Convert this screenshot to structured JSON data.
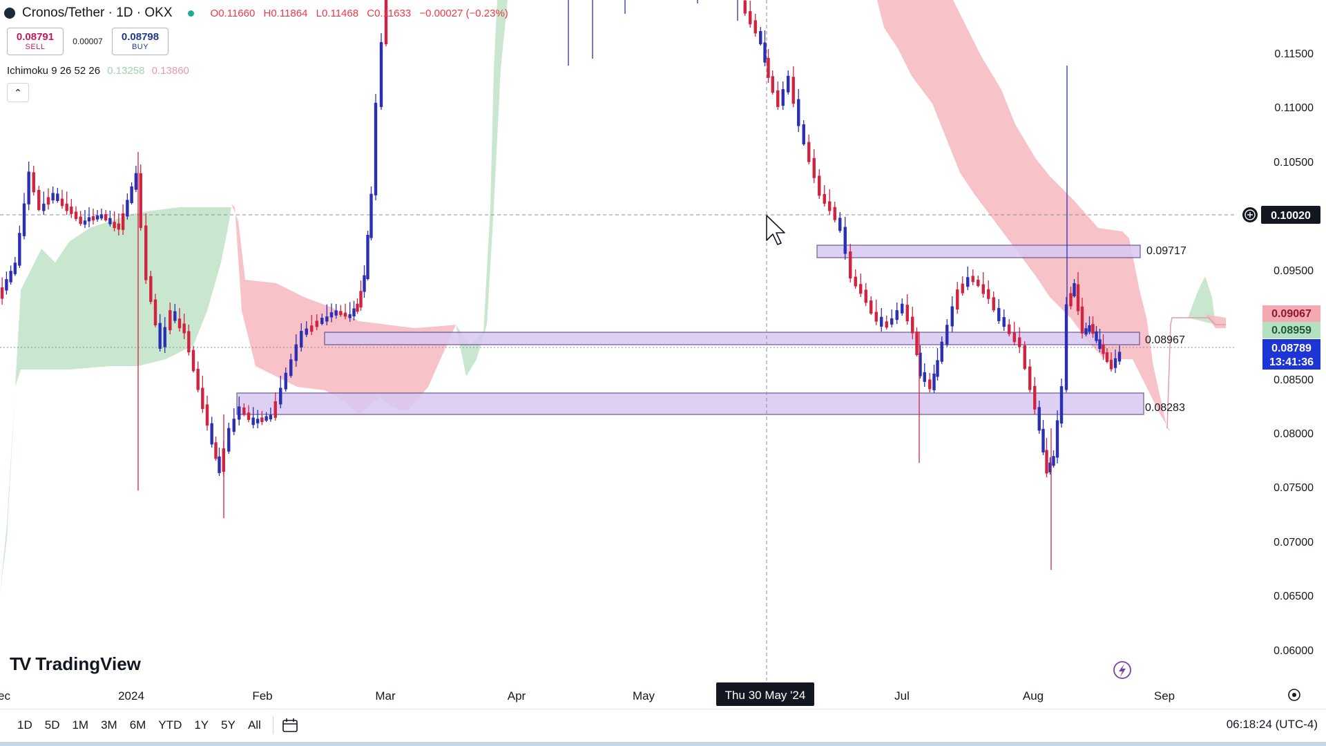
{
  "header": {
    "symbol": "Cronos/Tether · 1D · OKX",
    "open": "O0.11660",
    "high": "H0.11864",
    "low": "L0.11468",
    "close": "C0.11633",
    "change": "−0.00027 (−0.23%)"
  },
  "trade": {
    "sell_price": "0.08791",
    "sell_label": "SELL",
    "spread": "0.00007",
    "buy_price": "0.08798",
    "buy_label": "BUY"
  },
  "indicator": {
    "name": "Ichimoku 9 26 52 26",
    "value_a": "0.13258",
    "value_b": "0.13860"
  },
  "brand": "TradingView",
  "price_axis": {
    "ticks": [
      "0.11500",
      "0.11000",
      "0.10500",
      "0.09500",
      "0.08500",
      "0.08000",
      "0.07500",
      "0.07000",
      "0.06500",
      "0.06000"
    ],
    "crosshair_price": "0.10020",
    "tag_red": "0.09067",
    "tag_green": "0.08959",
    "last_price": "0.08789",
    "countdown": "13:41:36"
  },
  "time_axis": {
    "labels": [
      "ec",
      "2024",
      "Feb",
      "Mar",
      "Apr",
      "May",
      "Jul",
      "Aug",
      "Sep"
    ],
    "crosshair_date": "Thu 30 May '24"
  },
  "zones": [
    "0.09717",
    "0.08967",
    "0.08283"
  ],
  "ranges": [
    "1D",
    "5D",
    "1M",
    "3M",
    "6M",
    "YTD",
    "1Y",
    "5Y",
    "All"
  ],
  "clock": "06:18:24 (UTC-4)",
  "colors": {
    "up": "#2a2fb3",
    "down": "#d1233f",
    "cloud_bear": "#f6b8bf",
    "cloud_bull": "#bfe3c6",
    "zone": "#d9c8f2"
  }
}
